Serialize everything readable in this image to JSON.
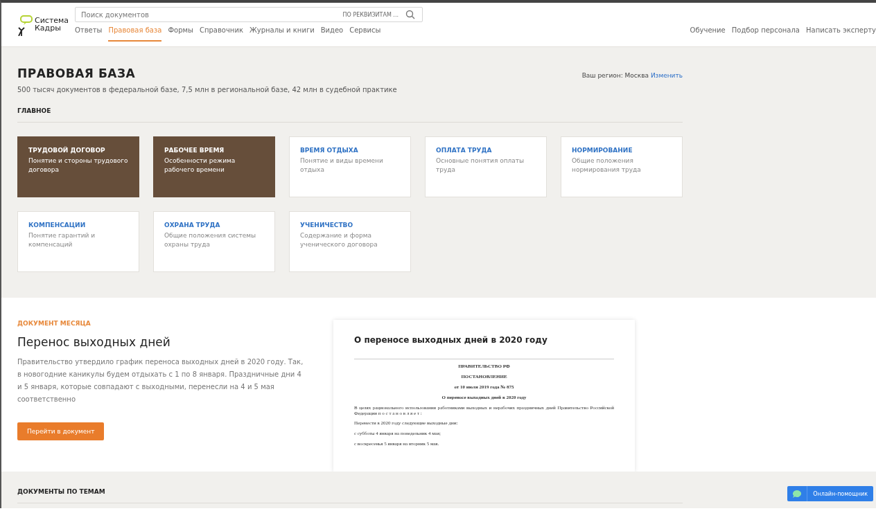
{
  "logo": {
    "line1": "Система",
    "line2": "Кадры"
  },
  "search": {
    "placeholder": "Поиск документов",
    "filter": "ПО РЕКВИЗИТАМ ..."
  },
  "nav": [
    {
      "label": "Ответы",
      "selected": false
    },
    {
      "label": "Правовая база",
      "selected": true
    },
    {
      "label": "Формы",
      "selected": false
    },
    {
      "label": "Справочник",
      "selected": false
    },
    {
      "label": "Журналы и книги",
      "selected": false
    },
    {
      "label": "Видео",
      "selected": false
    },
    {
      "label": "Сервисы",
      "selected": false
    }
  ],
  "nav_right": [
    "Обучение",
    "Подбор персонала",
    "Написать эксперту"
  ],
  "page": {
    "title": "ПРАВОВАЯ БАЗА",
    "subtitle": "500 тысяч документов в федеральной базе, 7,5 млн в региональной базе, 42 млн в судебной практике",
    "region_label": "Ваш регион: Москва",
    "region_link": "Изменить"
  },
  "main_section": {
    "title": "ГЛАВНОЕ",
    "cards": [
      {
        "title": "ТРУДОВОЙ ДОГОВОР",
        "text": "Понятие и стороны трудового договора",
        "featured": true
      },
      {
        "title": "РАБОЧЕЕ ВРЕМЯ",
        "text": "Особенности режима рабочего времени",
        "featured": true
      },
      {
        "title": "ВРЕМЯ ОТДЫХА",
        "text": "Понятие и виды времени отдыха",
        "featured": false
      },
      {
        "title": "ОПЛАТА ТРУДА",
        "text": "Основные понятия оплаты труда",
        "featured": false
      },
      {
        "title": "НОРМИРОВАНИЕ",
        "text": "Общие положения нормирования труда",
        "featured": false
      },
      {
        "title": "КОМПЕНСАЦИИ",
        "text": "Понятие гарантий и компенсаций",
        "featured": false
      },
      {
        "title": "ОХРАНА ТРУДА",
        "text": "Общие положения системы охраны труда",
        "featured": false
      },
      {
        "title": "УЧЕНИЧЕСТВО",
        "text": "Содержание и форма ученического договора",
        "featured": false
      }
    ]
  },
  "document_of_month": {
    "label": "ДОКУМЕНТ МЕСЯЦА",
    "title": "Перенос выходных дней",
    "text": "Правительство утвердило график переноса выходных дней в 2020 году. Так, в новогодние каникулы будем отдыхать с 1 по 8 января. Праздничные дни 4 и 5 января, которые совпадают с выходными, перенесли на 4 и 5 мая соответственно",
    "button": "Перейти в документ",
    "preview": {
      "title": "О переносе выходных дней в 2020 году",
      "lines": [
        {
          "kind": "heading",
          "text": "ПРАВИТЕЛЬСТВО РФ"
        },
        {
          "kind": "heading",
          "text": "ПОСТАНОВЛЕНИЕ"
        },
        {
          "kind": "heading",
          "text": "от 10 июля 2019 года № 875"
        },
        {
          "kind": "heading",
          "text": "О переносе выходных дней в 2020 году"
        },
        {
          "kind": "justified",
          "text": "В целях рационального использования работниками выходных и нерабочих праздничных дней Правительство Российской Федерации п о с т а н о в л я е т :"
        },
        {
          "kind": "plain",
          "text": "Перенести в 2020 году следующие выходные дни:"
        },
        {
          "kind": "plain",
          "text": "с субботы 4 января на понедельник 4 мая;"
        },
        {
          "kind": "plain",
          "text": "с воскресенья 5 января на вторник 5 мая."
        }
      ]
    }
  },
  "topics": {
    "title": "ДОКУМЕНТЫ ПО ТЕМАМ"
  },
  "chat_button": "Онлайн-помощник"
}
